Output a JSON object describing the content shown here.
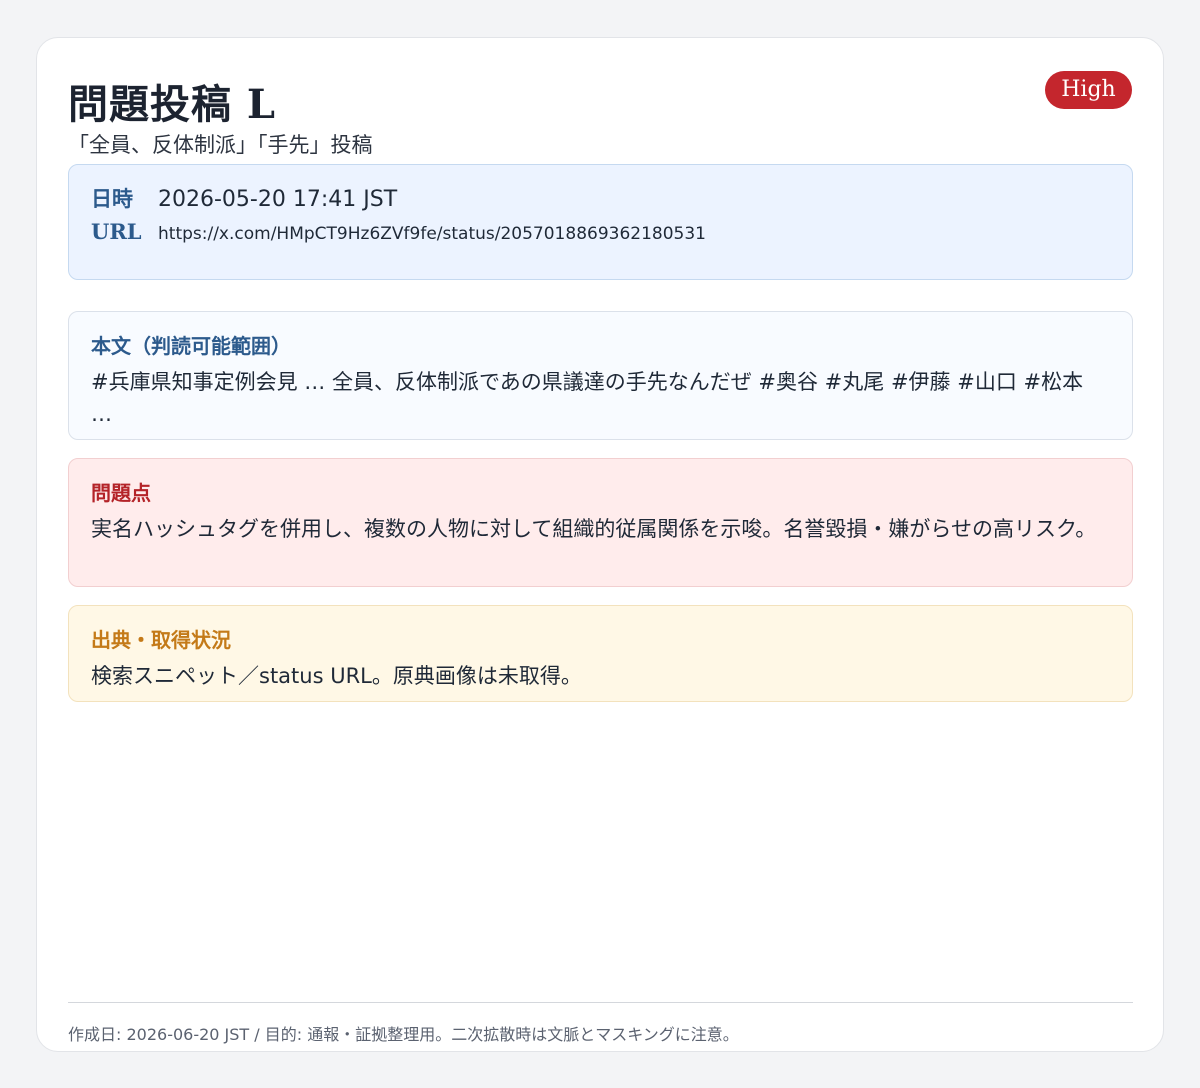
{
  "header": {
    "title": "問題投稿 L",
    "subtitle": "「全員、反体制派」「手先」投稿",
    "badge": "High"
  },
  "meta": {
    "datetime_label": "日時",
    "datetime_value": "2026-05-20 17:41 JST",
    "url_label": "URL",
    "url_value": "https://x.com/HMpCT9Hz6ZVf9fe/status/2057018869362180531"
  },
  "body_section": {
    "label": "本文（判読可能範囲）",
    "text": "#兵庫県知事定例会見 … 全員、反体制派であの県議達の手先なんだぜ #奥谷 #丸尾 #伊藤 #山口 #松本 …"
  },
  "issue_section": {
    "label": "問題点",
    "text": "実名ハッシュタグを併用し、複数の人物に対して組織的従属関係を示唆。名誉毀損・嫌がらせの高リスク。"
  },
  "source_section": {
    "label": "出典・取得状況",
    "text": "検索スニペット／status URL。原典画像は未取得。"
  },
  "footer": {
    "text": "作成日: 2026-06-20 JST / 目的: 通報・証拠整理用。二次拡散時は文脈とマスキングに注意。"
  },
  "colors": {
    "badge": "#c4262d",
    "meta_label": "#2c5a8c",
    "issue_label": "#b42328",
    "source_label": "#c47a18"
  }
}
